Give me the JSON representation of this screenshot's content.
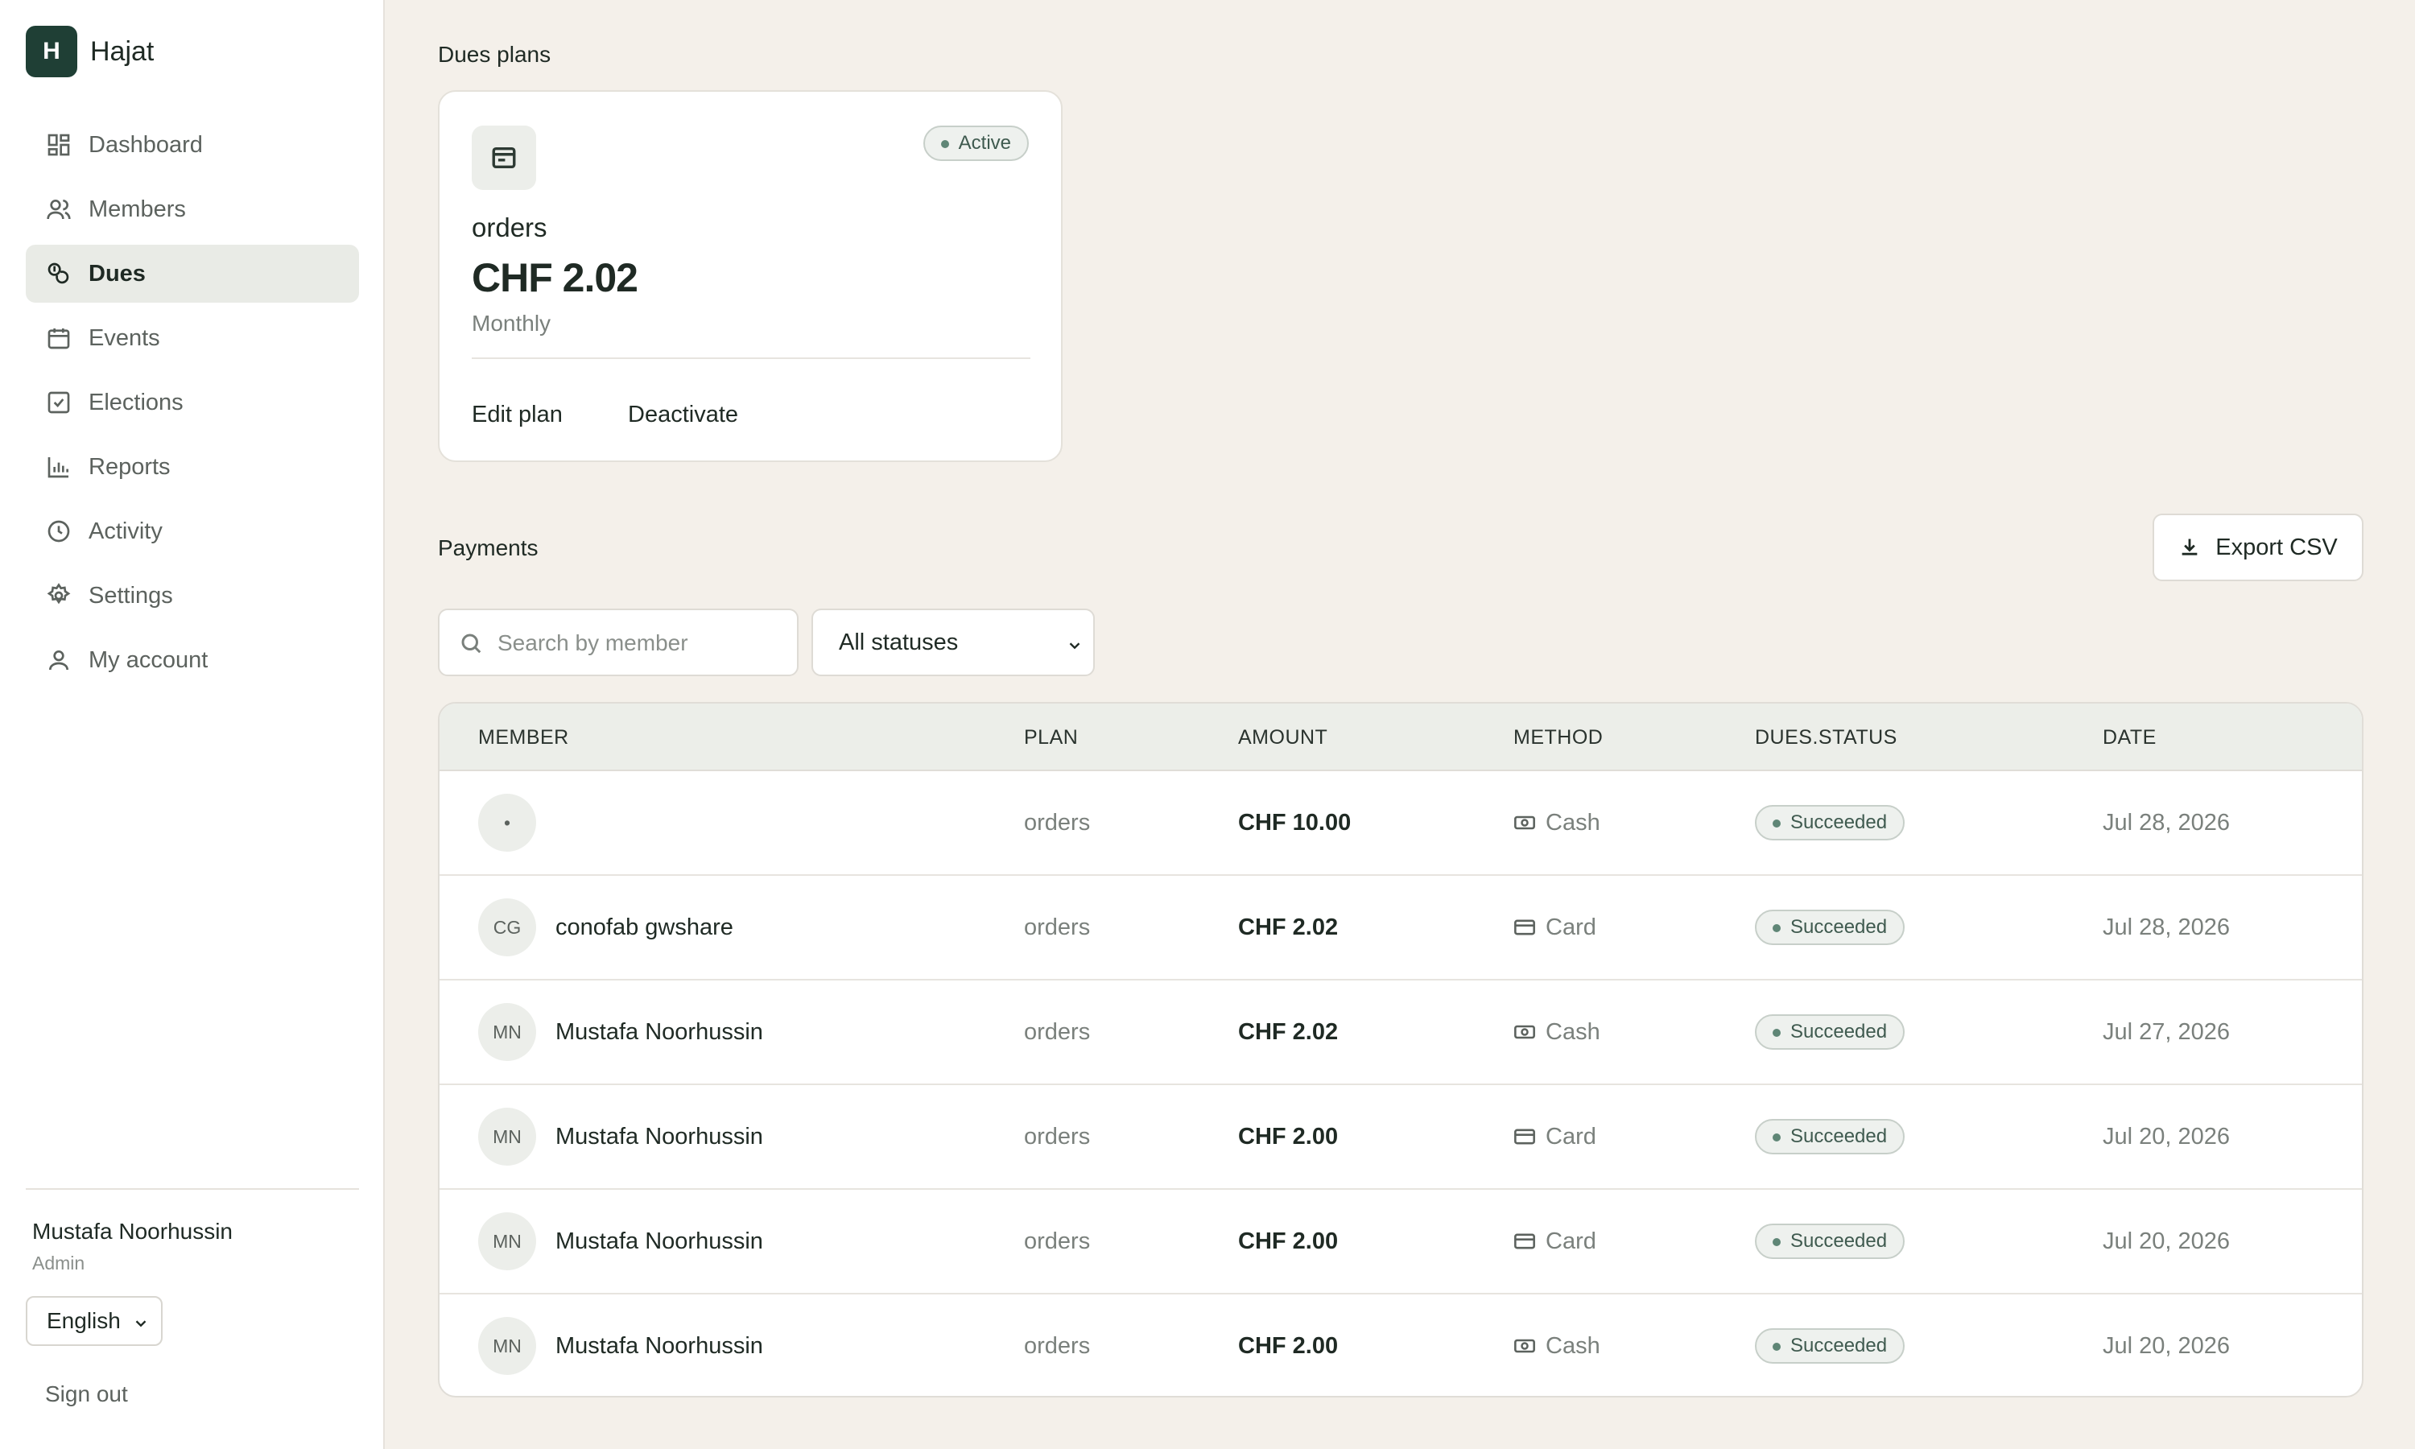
{
  "brand": {
    "initial": "H",
    "name": "Hajat"
  },
  "sidebar": {
    "items": [
      {
        "label": "Dashboard",
        "icon": "dashboard-icon"
      },
      {
        "label": "Members",
        "icon": "members-icon"
      },
      {
        "label": "Dues",
        "icon": "dues-icon",
        "active": true
      },
      {
        "label": "Events",
        "icon": "calendar-icon"
      },
      {
        "label": "Elections",
        "icon": "checkbox-icon"
      },
      {
        "label": "Reports",
        "icon": "bar-chart-icon"
      },
      {
        "label": "Activity",
        "icon": "clock-icon"
      },
      {
        "label": "Settings",
        "icon": "gear-icon"
      },
      {
        "label": "My account",
        "icon": "user-icon"
      }
    ],
    "user": {
      "name": "Mustafa Noorhussin",
      "role": "Admin"
    },
    "language": "English",
    "signout": "Sign out"
  },
  "dues_plans": {
    "title": "Dues plans",
    "plan": {
      "status": "Active",
      "name": "orders",
      "amount": "CHF 2.02",
      "frequency": "Monthly",
      "edit_label": "Edit plan",
      "deactivate_label": "Deactivate"
    }
  },
  "payments": {
    "title": "Payments",
    "export_label": "Export CSV",
    "search_placeholder": "Search by member",
    "status_filter": "All statuses",
    "columns": [
      "MEMBER",
      "PLAN",
      "AMOUNT",
      "METHOD",
      "DUES.STATUS",
      "DATE"
    ],
    "rows": [
      {
        "initials": "•",
        "member": "",
        "plan": "orders",
        "amount": "CHF 10.00",
        "method": "Cash",
        "status": "Succeeded",
        "date": "Jul 28, 2026"
      },
      {
        "initials": "CG",
        "member": "conofab gwshare",
        "plan": "orders",
        "amount": "CHF 2.02",
        "method": "Card",
        "status": "Succeeded",
        "date": "Jul 28, 2026"
      },
      {
        "initials": "MN",
        "member": "Mustafa Noorhussin",
        "plan": "orders",
        "amount": "CHF 2.02",
        "method": "Cash",
        "status": "Succeeded",
        "date": "Jul 27, 2026"
      },
      {
        "initials": "MN",
        "member": "Mustafa Noorhussin",
        "plan": "orders",
        "amount": "CHF 2.00",
        "method": "Card",
        "status": "Succeeded",
        "date": "Jul 20, 2026"
      },
      {
        "initials": "MN",
        "member": "Mustafa Noorhussin",
        "plan": "orders",
        "amount": "CHF 2.00",
        "method": "Card",
        "status": "Succeeded",
        "date": "Jul 20, 2026"
      },
      {
        "initials": "MN",
        "member": "Mustafa Noorhussin",
        "plan": "orders",
        "amount": "CHF 2.00",
        "method": "Cash",
        "status": "Succeeded",
        "date": "Jul 20, 2026"
      }
    ]
  },
  "colors": {
    "accent": "#1f3f35",
    "background": "#f4f0ea",
    "badge": "#eef1ee"
  }
}
